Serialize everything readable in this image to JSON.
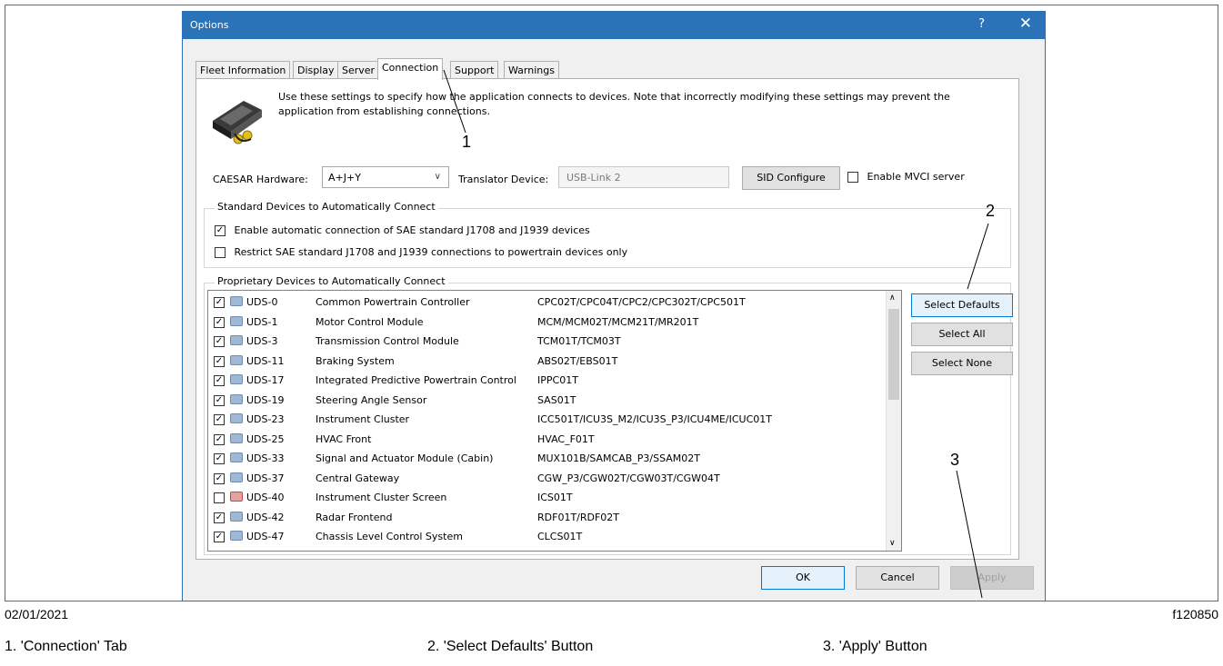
{
  "dialog": {
    "title": "Options",
    "help_label": "?",
    "close_label": "✕",
    "tabs": [
      "Fleet Information",
      "Display",
      "Server",
      "Connection",
      "Support",
      "Warnings"
    ],
    "active_tab": "Connection",
    "intro_text": "Use these settings to specify how the application connects to devices.  Note that incorrectly modifying these settings may prevent the application from establishing connections.",
    "caesar_label": "CAESAR Hardware:",
    "caesar_value": "A+J+Y",
    "translator_label": "Translator Device:",
    "translator_value": "USB-Link 2",
    "sid_button": "SID Configure",
    "mvci_label": "Enable MVCI server",
    "mvci_checked": false,
    "standard_group": {
      "title": "Standard Devices to Automatically Connect",
      "options": [
        {
          "label": "Enable automatic connection of SAE standard J1708 and J1939 devices",
          "checked": true
        },
        {
          "label": "Restrict SAE standard J1708 and J1939 connections to powertrain devices only",
          "checked": false
        }
      ]
    },
    "proprietary_group": {
      "title": "Proprietary Devices to Automatically Connect",
      "devices": [
        {
          "id": "UDS-0",
          "name": "Common Powertrain Controller",
          "variants": "CPC02T/CPC04T/CPC2/CPC302T/CPC501T",
          "checked": true,
          "warn": false
        },
        {
          "id": "UDS-1",
          "name": "Motor Control Module",
          "variants": "MCM/MCM02T/MCM21T/MR201T",
          "checked": true,
          "warn": false
        },
        {
          "id": "UDS-3",
          "name": "Transmission Control Module",
          "variants": "TCM01T/TCM03T",
          "checked": true,
          "warn": false
        },
        {
          "id": "UDS-11",
          "name": "Braking System",
          "variants": "ABS02T/EBS01T",
          "checked": true,
          "warn": false
        },
        {
          "id": "UDS-17",
          "name": "Integrated Predictive Powertrain Control",
          "variants": "IPPC01T",
          "checked": true,
          "warn": false
        },
        {
          "id": "UDS-19",
          "name": "Steering Angle Sensor",
          "variants": "SAS01T",
          "checked": true,
          "warn": false
        },
        {
          "id": "UDS-23",
          "name": "Instrument Cluster",
          "variants": "ICC501T/ICU3S_M2/ICU3S_P3/ICU4ME/ICUC01T",
          "checked": true,
          "warn": false
        },
        {
          "id": "UDS-25",
          "name": "HVAC Front",
          "variants": "HVAC_F01T",
          "checked": true,
          "warn": false
        },
        {
          "id": "UDS-33",
          "name": "Signal and Actuator Module (Cabin)",
          "variants": "MUX101B/SAMCAB_P3/SSAM02T",
          "checked": true,
          "warn": false
        },
        {
          "id": "UDS-37",
          "name": "Central Gateway",
          "variants": "CGW_P3/CGW02T/CGW03T/CGW04T",
          "checked": true,
          "warn": false
        },
        {
          "id": "UDS-40",
          "name": "Instrument Cluster Screen",
          "variants": "ICS01T",
          "checked": false,
          "warn": true
        },
        {
          "id": "UDS-42",
          "name": "Radar Frontend",
          "variants": "RDF01T/RDF02T",
          "checked": true,
          "warn": false
        },
        {
          "id": "UDS-47",
          "name": "Chassis Level Control System",
          "variants": "CLCS01T",
          "checked": true,
          "warn": false
        }
      ]
    },
    "select_defaults": "Select Defaults",
    "select_all": "Select All",
    "select_none": "Select None",
    "ok": "OK",
    "cancel": "Cancel",
    "apply": "Apply"
  },
  "callouts": [
    "1",
    "2",
    "3"
  ],
  "footer": {
    "date": "02/01/2021",
    "figure_id": "f120850"
  },
  "captions": [
    "1.  'Connection' Tab",
    "2.  'Select Defaults' Button",
    "3.  'Apply' Button"
  ]
}
